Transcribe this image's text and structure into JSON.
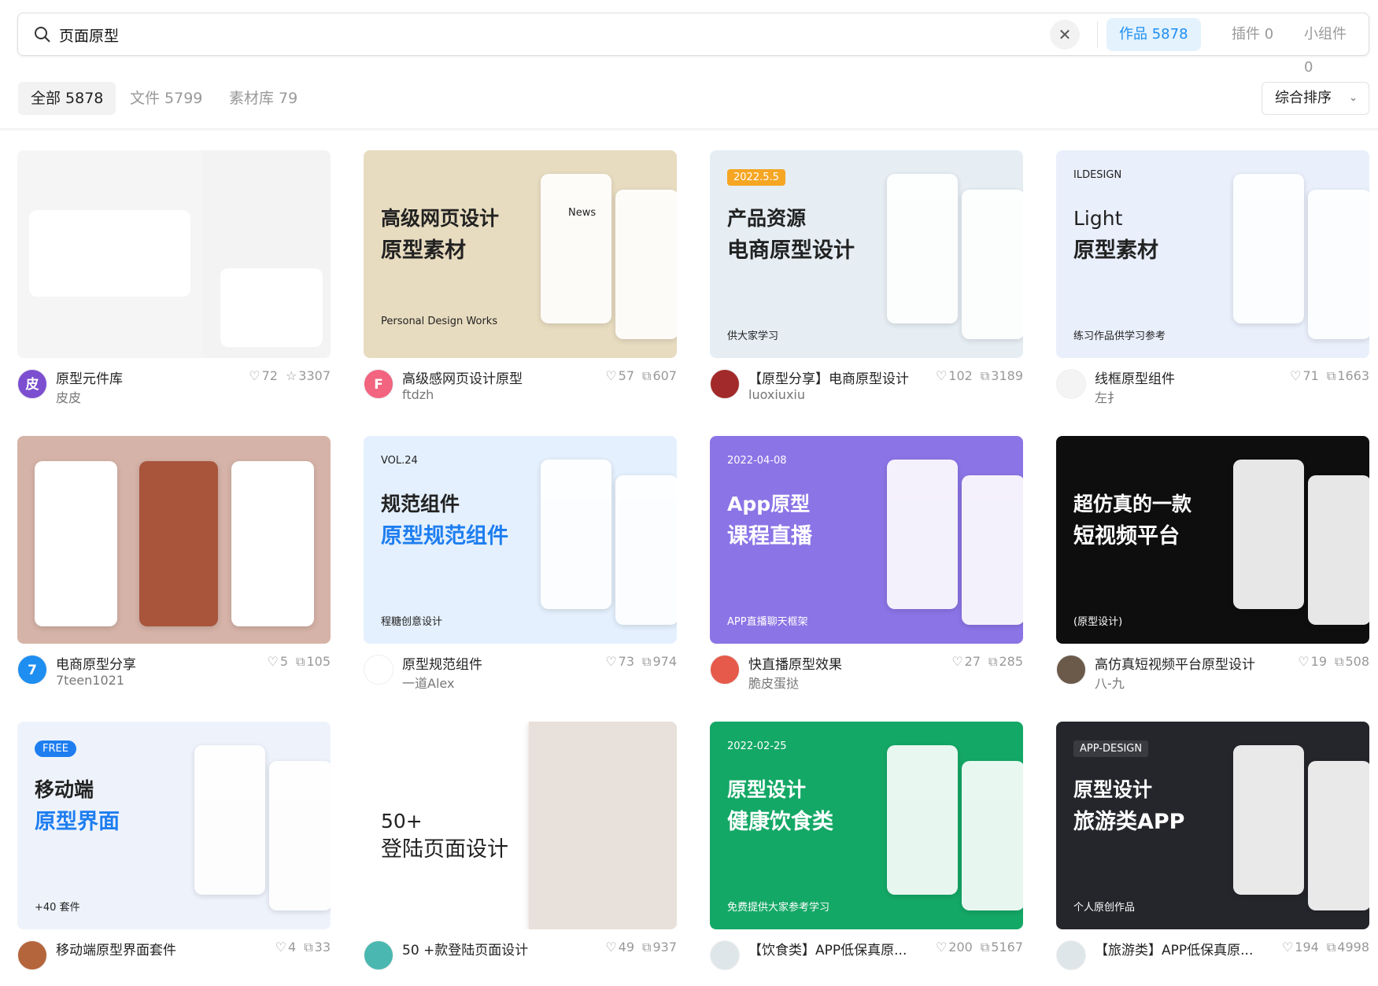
{
  "search": {
    "value": "页面原型",
    "clear_icon": "close-icon",
    "search_icon": "search-icon",
    "type_tabs": [
      {
        "label": "作品 5878",
        "active": true
      },
      {
        "label": "插件 0"
      },
      {
        "label": "小组件 0"
      }
    ]
  },
  "filters": {
    "tabs": [
      {
        "label": "全部 5878",
        "active": true
      },
      {
        "label": "文件 5799"
      },
      {
        "label": "素材库 79"
      }
    ],
    "sort": "综合排序"
  },
  "accent": "#1e8ef0",
  "cards": [
    {
      "title": "原型元件库",
      "author": "皮皮",
      "likes": "72",
      "stat2": "3307",
      "stat2_icon": "star-icon",
      "avatar": "皮",
      "avatar_color": "#7b4fd0",
      "bg": "#f3f3f3",
      "h1": "",
      "h2": "",
      "tag": ""
    },
    {
      "title": "高级感网页设计原型",
      "author": "ftdzh",
      "likes": "57",
      "stat2": "607",
      "stat2_icon": "copy-icon",
      "avatar": "F",
      "avatar_color": "#f2647f",
      "bg": "#e8dcc0",
      "h1": "高级网页设计",
      "h2": "原型素材",
      "tag": "Personal Design Works",
      "extra": "News"
    },
    {
      "title": "【原型分享】电商原型设计",
      "author": "luoxiuxiu",
      "likes": "102",
      "stat2": "3189",
      "stat2_icon": "copy-icon",
      "avatar": "",
      "avatar_color": "#a32a2a",
      "bg": "#e6eef4",
      "h1": "产品资源",
      "h2": "电商原型设计",
      "tag": "2022.5.5",
      "extra": "供大家学习"
    },
    {
      "title": "线框原型组件",
      "author": "左扌",
      "likes": "71",
      "stat2": "1663",
      "stat2_icon": "copy-icon",
      "avatar": "",
      "avatar_color": "#f4f4f4",
      "bg": "#e9effb",
      "h1": "Light",
      "h2": "原型素材",
      "tag": "ILDESIGN",
      "extra": "练习作品供学习参考"
    },
    {
      "title": "电商原型分享",
      "author": "7teen1021",
      "likes": "5",
      "stat2": "105",
      "stat2_icon": "copy-icon",
      "avatar": "7",
      "avatar_color": "#1e8ef0",
      "bg": "#d6b3a8",
      "h1": "",
      "h2": "",
      "tag": ""
    },
    {
      "title": "原型规范组件",
      "author": "一道Alex",
      "likes": "73",
      "stat2": "974",
      "stat2_icon": "copy-icon",
      "avatar": "",
      "avatar_color": "#ffffff",
      "bg": "#e4f0fd",
      "h1": "规范组件",
      "h2": "原型规范组件",
      "tag": "VOL.24",
      "extra": "程糖创意设计"
    },
    {
      "title": "快直播原型效果",
      "author": "脆皮蛋挞",
      "likes": "27",
      "stat2": "285",
      "stat2_icon": "copy-icon",
      "avatar": "",
      "avatar_color": "#e55a4a",
      "bg": "#8b74e6",
      "h1": "App原型",
      "h2": "课程直播",
      "tag": "2022-04-08",
      "extra": "APP直播聊天框架"
    },
    {
      "title": "高仿真短视频平台原型设计",
      "author": "八-九",
      "likes": "19",
      "stat2": "508",
      "stat2_icon": "copy-icon",
      "avatar": "",
      "avatar_color": "#6b5a4a",
      "bg": "#0e0e0e",
      "h1": "超仿真的一款",
      "h2": "短视频平台",
      "tag": "",
      "extra": "(原型设计)"
    },
    {
      "title": "移动端原型界面套件",
      "author": "",
      "likes": "4",
      "stat2": "33",
      "stat2_icon": "copy-icon",
      "avatar": "",
      "avatar_color": "#b5653c",
      "bg": "#eef3fb",
      "h1": "移动端",
      "h2": "原型界面",
      "tag": "FREE",
      "extra": "+40 套件"
    },
    {
      "title": "50 +款登陆页面设计",
      "author": "",
      "likes": "49",
      "stat2": "937",
      "stat2_icon": "copy-icon",
      "avatar": "",
      "avatar_color": "#4ab8b0",
      "bg": "#ffffff",
      "h1": "50+",
      "h2": "登陆页面设计",
      "tag": "",
      "extra": ""
    },
    {
      "title": "【饮食类】APP低保真原...",
      "author": "",
      "likes": "200",
      "stat2": "5167",
      "stat2_icon": "copy-icon",
      "avatar": "",
      "avatar_color": "#dfe6ea",
      "bg": "#14a866",
      "h1": "原型设计",
      "h2": "健康饮食类",
      "tag": "2022-02-25",
      "extra": "免费提供大家参考学习"
    },
    {
      "title": "【旅游类】APP低保真原...",
      "author": "",
      "likes": "194",
      "stat2": "4998",
      "stat2_icon": "copy-icon",
      "avatar": "",
      "avatar_color": "#dfe6ea",
      "bg": "#25262b",
      "h1": "原型设计",
      "h2": "旅游类APP",
      "tag": "APP-DESIGN",
      "extra": "个人原创作品"
    }
  ]
}
